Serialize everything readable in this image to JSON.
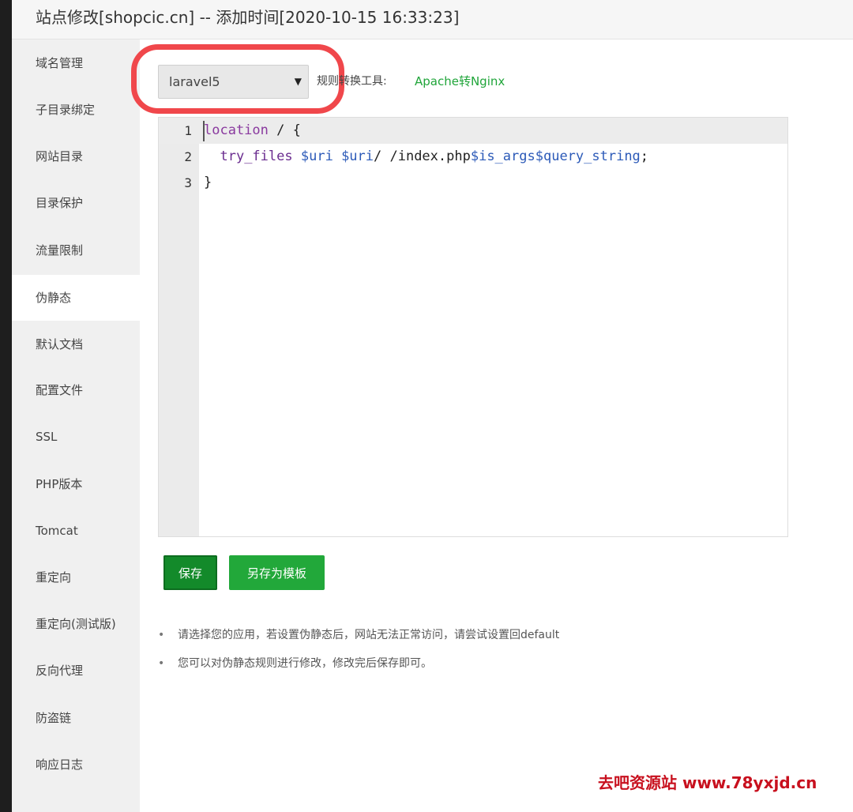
{
  "window": {
    "title": "站点修改[shopcic.cn] -- 添加时间[2020-10-15 16:33:23]"
  },
  "sidebar": {
    "items": [
      {
        "label": "域名管理"
      },
      {
        "label": "子目录绑定"
      },
      {
        "label": "网站目录"
      },
      {
        "label": "目录保护"
      },
      {
        "label": "流量限制"
      },
      {
        "label": "伪静态",
        "active": true
      },
      {
        "label": "默认文档"
      },
      {
        "label": "配置文件"
      },
      {
        "label": "SSL"
      },
      {
        "label": "PHP版本"
      },
      {
        "label": "Tomcat"
      },
      {
        "label": "重定向"
      },
      {
        "label": "重定向(测试版)"
      },
      {
        "label": "反向代理"
      },
      {
        "label": "防盗链"
      },
      {
        "label": "响应日志"
      }
    ]
  },
  "rewrite": {
    "select_value": "laravel5",
    "tool_label": "规则转换工具:",
    "tool_link": "Apache转Nginx"
  },
  "editor": {
    "line_numbers": [
      "1",
      "2",
      "3"
    ],
    "lines": [
      {
        "keyword": "location",
        "rest": " / {"
      },
      {
        "indent": "  ",
        "func": "try_files",
        "sp1": " ",
        "var1": "$uri",
        "sp2": " ",
        "var2": "$uri",
        "text1": "/ /index.php",
        "var3": "$is_args",
        "var4": "$query_string",
        "end": ";"
      },
      {
        "text": "}"
      }
    ]
  },
  "buttons": {
    "save": "保存",
    "save_as_template": "另存为模板"
  },
  "tips": [
    "请选择您的应用，若设置伪静态后，网站无法正常访问，请尝试设置回default",
    "您可以对伪静态规则进行修改，修改完后保存即可。"
  ],
  "watermark": "去吧资源站 www.78yxjd.cn",
  "colors": {
    "accent_green": "#20a53a",
    "highlight_red": "#f0474b",
    "watermark_red": "#c8101e"
  }
}
